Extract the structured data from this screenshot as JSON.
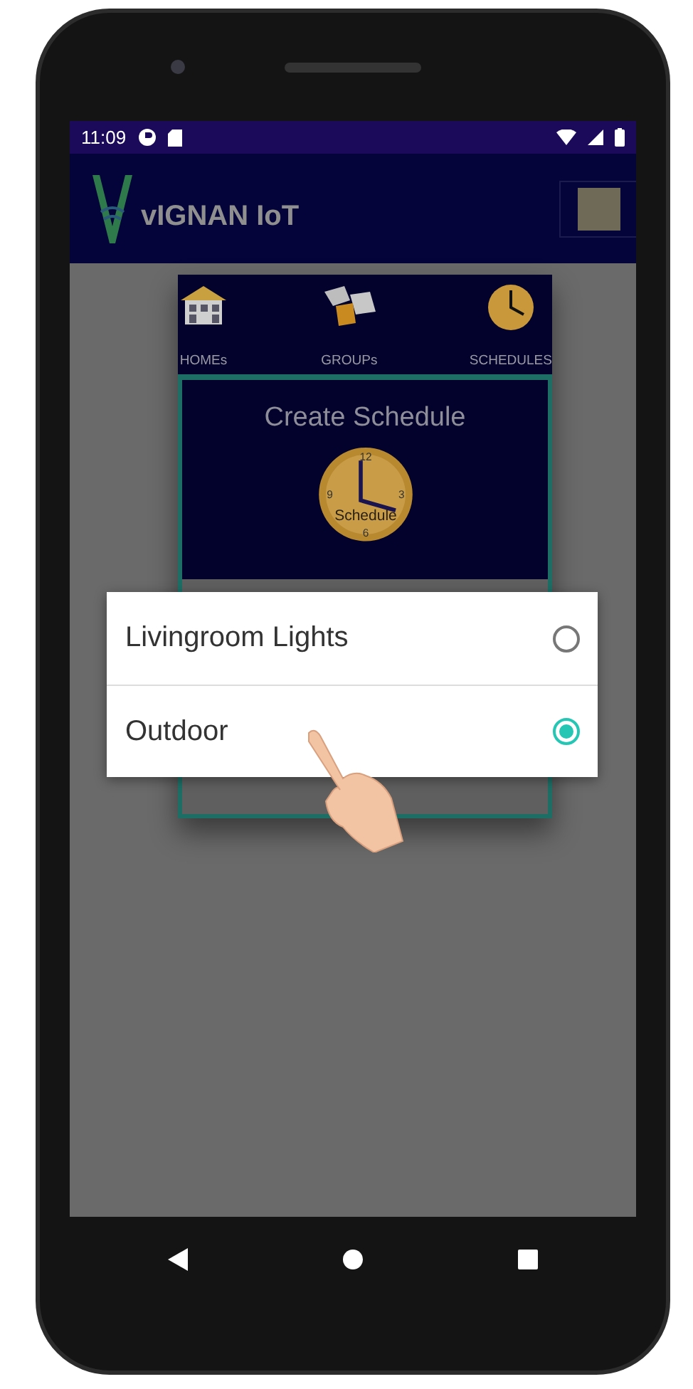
{
  "status_bar": {
    "time": "11:09"
  },
  "app_bar": {
    "title": "vIGNAN IoT"
  },
  "nav_tabs": [
    {
      "label": "HOMEs",
      "kind": "home"
    },
    {
      "label": "GROUPs",
      "kind": "groups"
    },
    {
      "label": "SCHEDULES",
      "kind": "schedule"
    }
  ],
  "card": {
    "title": "Create Schedule",
    "clock_label": "Schedule",
    "clock_numbers": [
      "12",
      "3",
      "6",
      "9"
    ]
  },
  "dialog": {
    "options": [
      {
        "label": "Livingroom Lights",
        "selected": false
      },
      {
        "label": "Outdoor",
        "selected": true
      }
    ]
  }
}
